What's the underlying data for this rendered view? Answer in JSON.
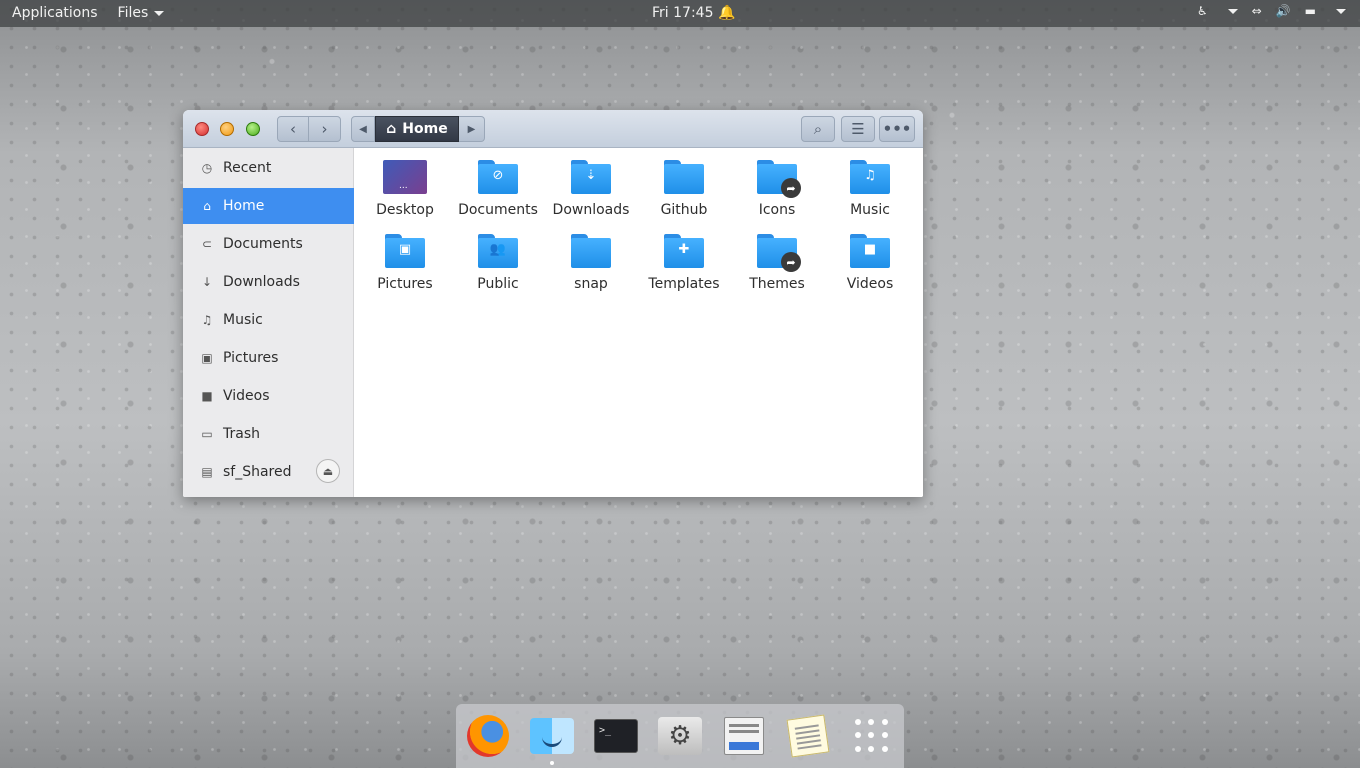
{
  "topbar": {
    "applications": "Applications",
    "files_menu": "Files",
    "clock": "Fri 17:45"
  },
  "window": {
    "path": "Home",
    "sidebar": [
      {
        "label": "Recent",
        "icon": "clock-icon"
      },
      {
        "label": "Home",
        "icon": "home-icon",
        "active": true
      },
      {
        "label": "Documents",
        "icon": "paperclip-icon"
      },
      {
        "label": "Downloads",
        "icon": "download-icon"
      },
      {
        "label": "Music",
        "icon": "music-icon"
      },
      {
        "label": "Pictures",
        "icon": "picture-icon"
      },
      {
        "label": "Videos",
        "icon": "video-icon"
      },
      {
        "label": "Trash",
        "icon": "trash-icon"
      },
      {
        "label": "sf_Shared",
        "icon": "drive-icon"
      }
    ],
    "files": [
      {
        "label": "Desktop"
      },
      {
        "label": "Documents"
      },
      {
        "label": "Downloads"
      },
      {
        "label": "Github"
      },
      {
        "label": "Icons"
      },
      {
        "label": "Music"
      },
      {
        "label": "Pictures"
      },
      {
        "label": "Public"
      },
      {
        "label": "snap"
      },
      {
        "label": "Templates"
      },
      {
        "label": "Themes"
      },
      {
        "label": "Videos"
      }
    ]
  },
  "dock": {
    "items": [
      "Firefox",
      "Files",
      "Terminal",
      "Settings",
      "Document Viewer",
      "Notes",
      "Show Applications"
    ]
  }
}
